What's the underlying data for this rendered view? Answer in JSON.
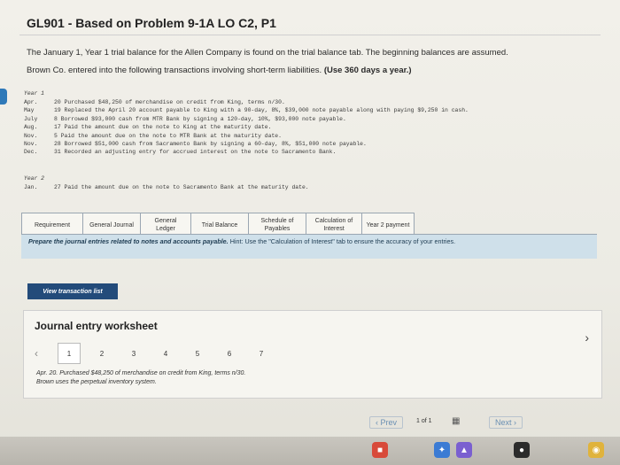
{
  "header": {
    "title": "GL901 - Based on Problem 9-1A LO C2, P1"
  },
  "intro": {
    "line1": "The January 1, Year 1 trial balance for the Allen Company is found on the trial balance tab. The beginning balances are assumed.",
    "line2": "Brown Co. entered into the following transactions involving short-term liabilities.",
    "line2_bold": "(Use 360 days a year.)"
  },
  "year1": {
    "label": "Year 1",
    "transactions": [
      {
        "month": "Apr.",
        "text": "20 Purchased $48,250 of merchandise on credit from King, terms n/30."
      },
      {
        "month": "May",
        "text": "19 Replaced the April 20 account payable to King with a 90-day, 8%, $39,000 note payable along with paying $9,250 in cash."
      },
      {
        "month": "July",
        "text": "8 Borrowed $93,000 cash from MTR Bank by signing a 120-day, 10%, $93,000 note payable."
      },
      {
        "month": "Aug.",
        "text": "17 Paid the amount due on the note to King at the maturity date."
      },
      {
        "month": "Nov.",
        "text": "5 Paid the amount due on the note to MTR Bank at the maturity date."
      },
      {
        "month": "Nov.",
        "text": "28 Borrowed $51,000 cash from Sacramento Bank by signing a 60-day, 8%, $51,000 note payable."
      },
      {
        "month": "Dec.",
        "text": "31 Recorded an adjusting entry for accrued interest on the note to Sacramento Bank."
      }
    ]
  },
  "year2": {
    "label": "Year 2",
    "month": "Jan.",
    "text": "27 Paid the amount due on the note to Sacramento Bank at the maturity date."
  },
  "tabs": [
    "Requirement",
    "General Journal",
    "General Ledger",
    "Trial Balance",
    "Schedule of Payables",
    "Calculation of Interest",
    "Year 2 payment"
  ],
  "instruction": {
    "bold": "Prepare the journal entries related to notes and accounts payable.",
    "hint": "Hint: Use the \"Calculation of Interest\" tab to ensure the accuracy of your entries."
  },
  "buttons": {
    "view_transaction_list": "View transaction list"
  },
  "worksheet": {
    "title": "Journal entry worksheet",
    "pages": [
      "1",
      "2",
      "3",
      "4",
      "5",
      "6",
      "7"
    ],
    "selected_page": "1",
    "description_date": "Apr. 20.",
    "description_text": "Purchased $48,250 of merchandise on credit from King, terms n/30.",
    "description_line2": "Brown uses the perpetual inventory system."
  },
  "pager": {
    "prev": "Prev",
    "count": "1 of 1",
    "next": "Next"
  },
  "colors": {
    "accent": "#234b7a",
    "instruction_bg": "#cfe0ea",
    "link": "#6a8fb3"
  }
}
